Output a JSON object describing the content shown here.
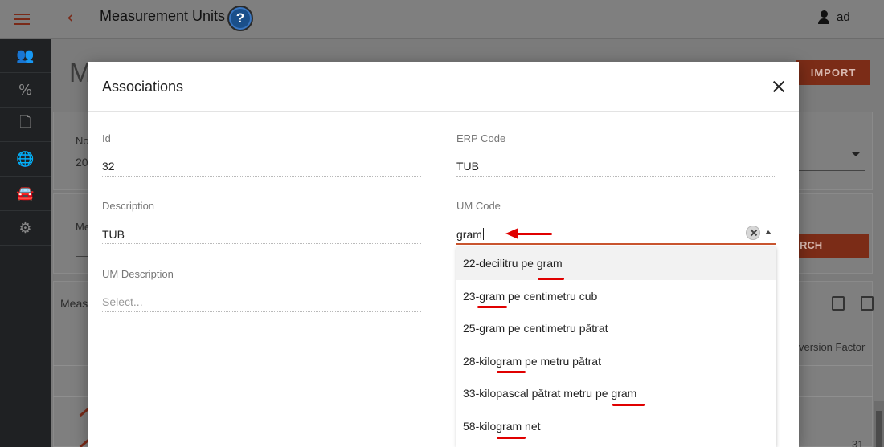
{
  "app": {
    "title": "Measurement Units",
    "user": "ad",
    "page_title_partial": "M",
    "import_label": "IMPORT",
    "search_label": "RCH",
    "bg_label_no": "No",
    "bg_value_no": "20",
    "bg_label_me": "Me",
    "bg_table_title": "Meas",
    "bg_col_conversion": "version Factor",
    "bg_row_value": "31"
  },
  "sidebar": {
    "items": [
      {
        "name": "users-icon",
        "glyph": "👥"
      },
      {
        "name": "percent-icon",
        "glyph": "%"
      },
      {
        "name": "document-icon",
        "glyph": "🗋"
      },
      {
        "name": "globe-icon",
        "glyph": "🌐"
      },
      {
        "name": "car-icon",
        "glyph": "🚘"
      },
      {
        "name": "gear-icon",
        "glyph": "⚙"
      }
    ]
  },
  "modal": {
    "title": "Associations",
    "fields": {
      "id": {
        "label": "Id",
        "value": "32"
      },
      "erp_code": {
        "label": "ERP Code",
        "value": "TUB"
      },
      "description": {
        "label": "Description",
        "value": "TUB"
      },
      "um_code": {
        "label": "UM Code",
        "value": "gram"
      },
      "um_description": {
        "label": "UM Description",
        "placeholder": "Select..."
      }
    },
    "options": [
      "22-decilitru pe gram",
      "23-gram pe centimetru cub",
      "25-gram pe centimetru pătrat",
      "28-kilogram pe metru pătrat",
      "33-kilopascal pătrat metru pe gram",
      "58-kilogram net"
    ]
  },
  "colors": {
    "accent": "#c9552f",
    "annotation": "#e00000",
    "help_icon": "#1a4f8a"
  }
}
